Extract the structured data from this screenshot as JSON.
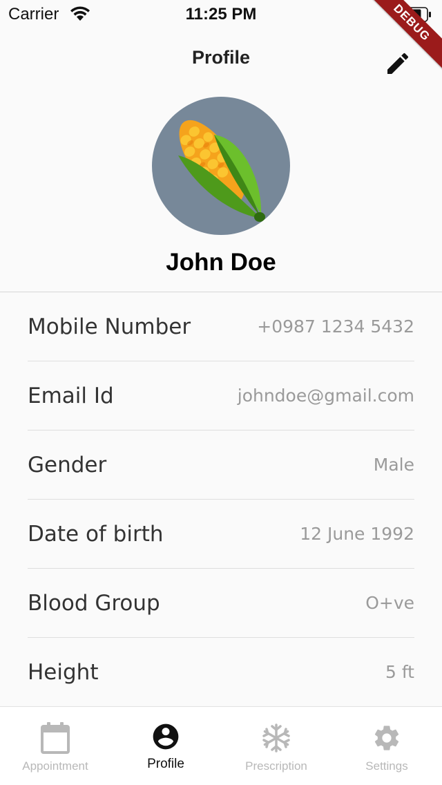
{
  "status_bar": {
    "carrier": "Carrier",
    "time": "11:25 PM",
    "debug_label": "DEBUG"
  },
  "nav": {
    "title": "Profile",
    "edit_icon": "pencil-icon"
  },
  "profile": {
    "avatar_icon": "corn-icon",
    "avatar_bg": "#778899",
    "name": "John Doe"
  },
  "info": [
    {
      "label": "Mobile Number",
      "value": "+0987 1234 5432"
    },
    {
      "label": "Email Id",
      "value": "johndoe@gmail.com"
    },
    {
      "label": "Gender",
      "value": "Male"
    },
    {
      "label": "Date of birth",
      "value": "12 June 1992"
    },
    {
      "label": "Blood Group",
      "value": "O+ve"
    },
    {
      "label": "Height",
      "value": "5 ft"
    }
  ],
  "tabs": [
    {
      "label": "Appointment",
      "icon": "calendar-icon",
      "active": false
    },
    {
      "label": "Profile",
      "icon": "account-circle-icon",
      "active": true
    },
    {
      "label": "Prescription",
      "icon": "snowflake-icon",
      "active": false
    },
    {
      "label": "Settings",
      "icon": "gear-icon",
      "active": false
    }
  ],
  "colors": {
    "active_tab": "#111111",
    "inactive_tab": "#b8b8b8",
    "value_text": "#9a9a9a",
    "debug_ribbon": "#9b1b1b"
  }
}
